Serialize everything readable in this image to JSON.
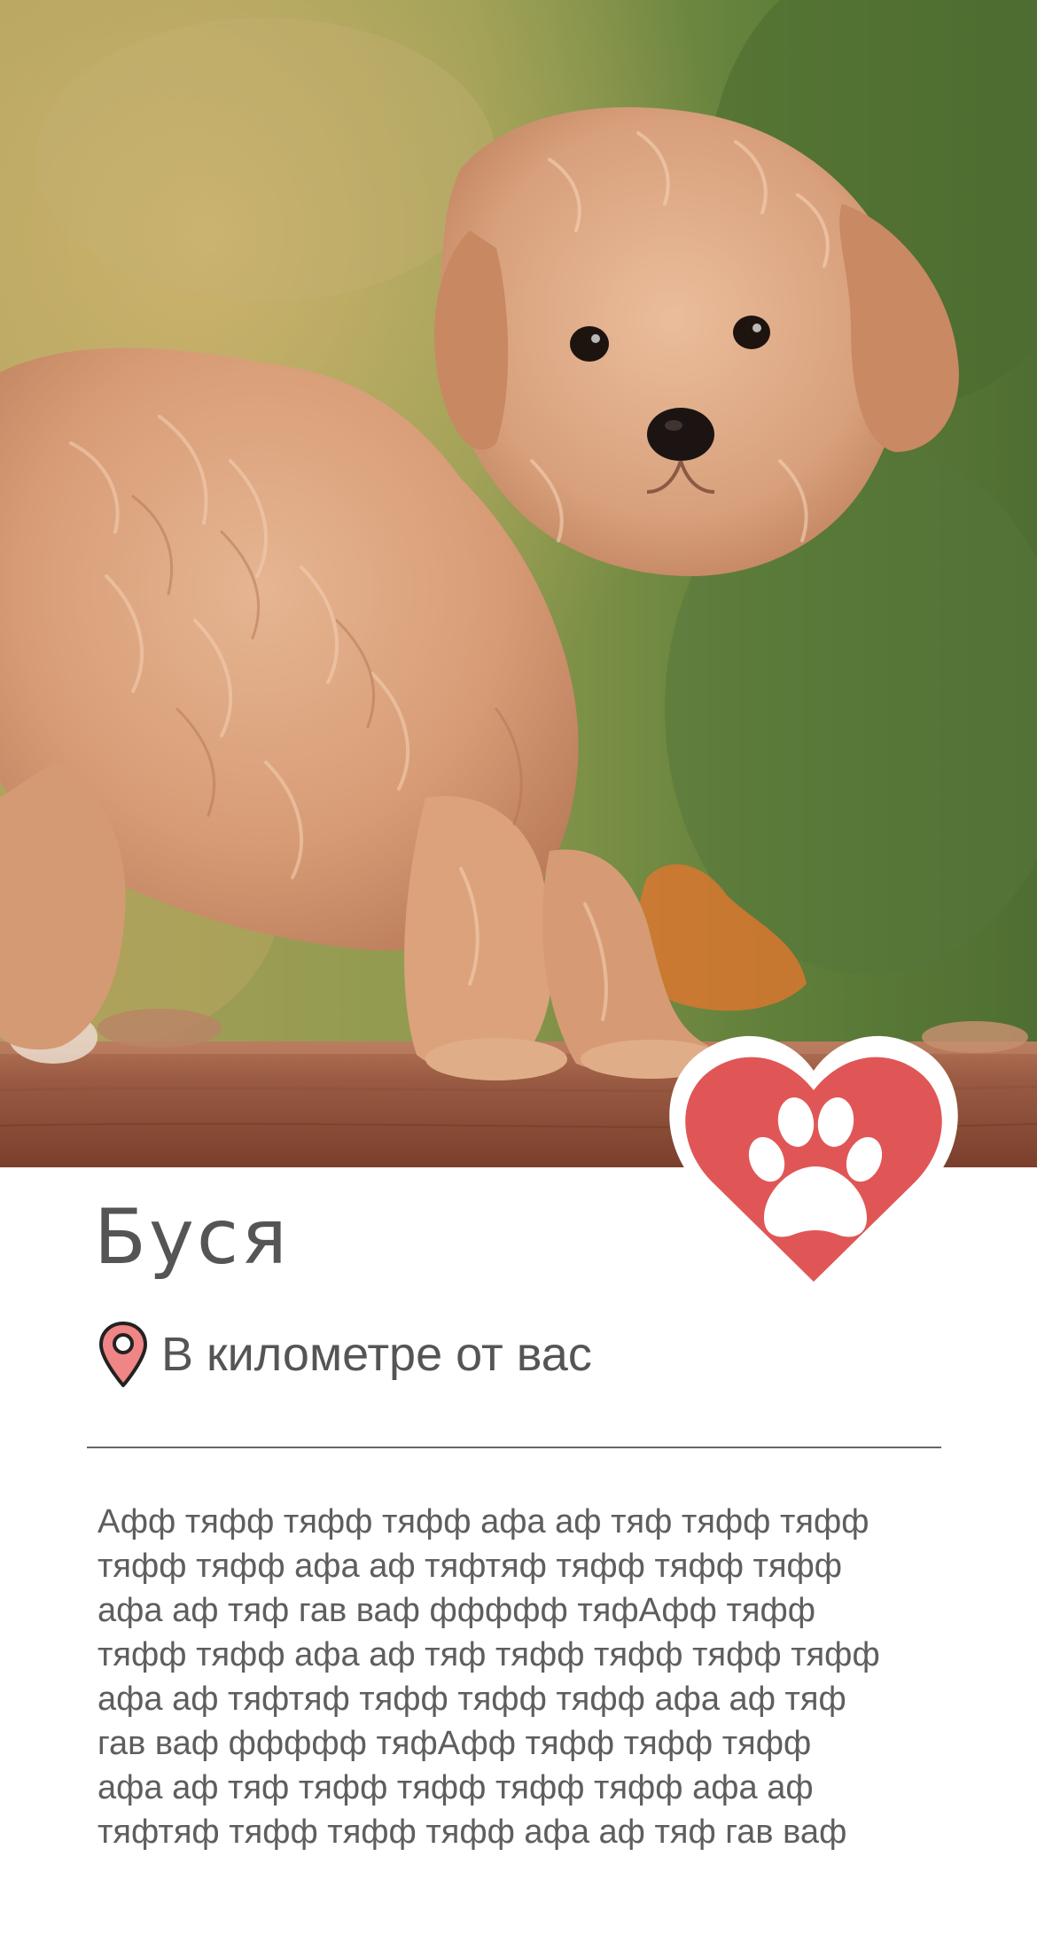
{
  "pet": {
    "name": "Буся",
    "distance": "В километре от вас",
    "description": "Афф тяфф тяфф тяфф афа аф тяф тяфф тяфф\nтяфф тяфф афа аф тяфтяф тяфф тяфф тяфф\nафа аф тяф гав ваф ффффф тяфАфф тяфф\nтяфф тяфф афа аф тяф тяфф тяфф тяфф тяфф\nафа аф тяфтяф тяфф тяфф тяфф афа аф тяф\nгав ваф ффффф тяфАфф тяфф тяфф тяфф\nафа аф тяф тяфф тяфф тяфф тяфф афа аф\nтяфтяф тяфф тяфф тяфф афа аф тяф гав ваф"
  },
  "icons": {
    "location": "map-pin-icon",
    "like": "heart-paw-icon"
  },
  "colors": {
    "accent": "#E05656",
    "pin_fill": "#F08585",
    "text": "#555555",
    "divider": "#666666",
    "background": "#FFFFFF"
  }
}
